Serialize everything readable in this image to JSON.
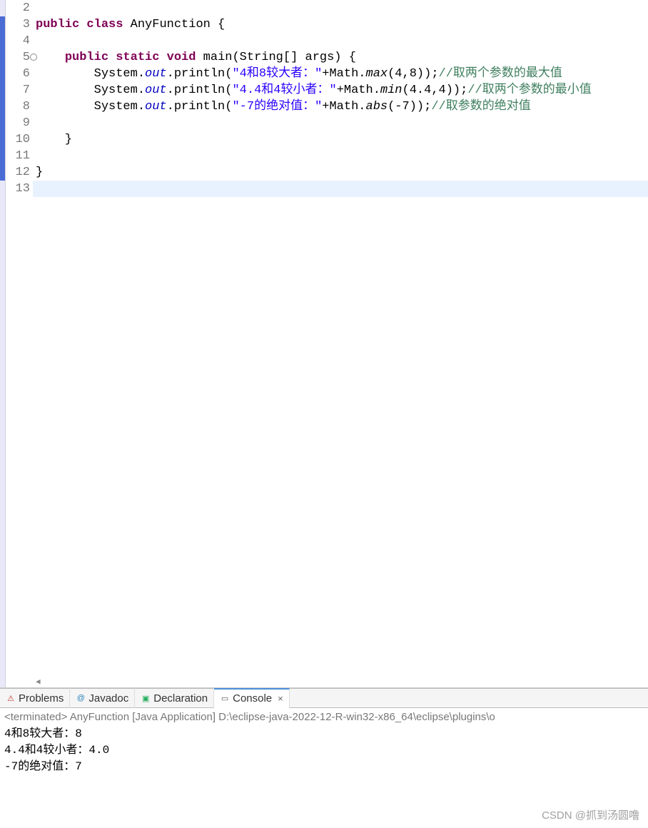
{
  "editor": {
    "gutter": [
      "2",
      "3",
      "4",
      "5",
      "6",
      "7",
      "8",
      "9",
      "10",
      "11",
      "12",
      "13"
    ],
    "override_line_index": 3,
    "lines": [
      {
        "tokens": []
      },
      {
        "tokens": [
          {
            "c": "kw",
            "t": "public"
          },
          {
            "c": "punc",
            "t": " "
          },
          {
            "c": "kw",
            "t": "class"
          },
          {
            "c": "punc",
            "t": " "
          },
          {
            "c": "cls",
            "t": "AnyFunction"
          },
          {
            "c": "punc",
            "t": " {"
          }
        ]
      },
      {
        "tokens": []
      },
      {
        "tokens": [
          {
            "c": "punc",
            "t": "    "
          },
          {
            "c": "kw",
            "t": "public"
          },
          {
            "c": "punc",
            "t": " "
          },
          {
            "c": "kw",
            "t": "static"
          },
          {
            "c": "punc",
            "t": " "
          },
          {
            "c": "kw",
            "t": "void"
          },
          {
            "c": "punc",
            "t": " main(String[] args) {"
          }
        ]
      },
      {
        "tokens": [
          {
            "c": "punc",
            "t": "        System."
          },
          {
            "c": "fld",
            "t": "out"
          },
          {
            "c": "punc",
            "t": ".println("
          },
          {
            "c": "str",
            "t": "\"4和8较大者：\""
          },
          {
            "c": "punc",
            "t": "+Math."
          },
          {
            "c": "mth",
            "t": "max"
          },
          {
            "c": "punc",
            "t": "(4,8));"
          },
          {
            "c": "cmt",
            "t": "//取两个参数的最大值"
          }
        ]
      },
      {
        "tokens": [
          {
            "c": "punc",
            "t": "        System."
          },
          {
            "c": "fld",
            "t": "out"
          },
          {
            "c": "punc",
            "t": ".println("
          },
          {
            "c": "str",
            "t": "\"4.4和4较小者：\""
          },
          {
            "c": "punc",
            "t": "+Math."
          },
          {
            "c": "mth",
            "t": "min"
          },
          {
            "c": "punc",
            "t": "(4.4,4));"
          },
          {
            "c": "cmt",
            "t": "//取两个参数的最小值"
          }
        ]
      },
      {
        "tokens": [
          {
            "c": "punc",
            "t": "        System."
          },
          {
            "c": "fld",
            "t": "out"
          },
          {
            "c": "punc",
            "t": ".println("
          },
          {
            "c": "str",
            "t": "\"-7的绝对值：\""
          },
          {
            "c": "punc",
            "t": "+Math."
          },
          {
            "c": "mth",
            "t": "abs"
          },
          {
            "c": "punc",
            "t": "(-7));"
          },
          {
            "c": "cmt",
            "t": "//取参数的绝对值"
          }
        ]
      },
      {
        "tokens": []
      },
      {
        "tokens": [
          {
            "c": "punc",
            "t": "    }"
          }
        ]
      },
      {
        "tokens": []
      },
      {
        "tokens": [
          {
            "c": "punc",
            "t": "}"
          }
        ]
      },
      {
        "tokens": [],
        "hl": true
      }
    ]
  },
  "tabs": {
    "problems": "Problems",
    "javadoc": "Javadoc",
    "declaration": "Declaration",
    "console": "Console"
  },
  "terminated_line": "<terminated> AnyFunction [Java Application] D:\\eclipse-java-2022-12-R-win32-x86_64\\eclipse\\plugins\\o",
  "console_output": [
    "4和8较大者：8",
    "4.4和4较小者：4.0",
    "-7的绝对值：7"
  ],
  "watermark": "CSDN @抓到汤圆噜"
}
